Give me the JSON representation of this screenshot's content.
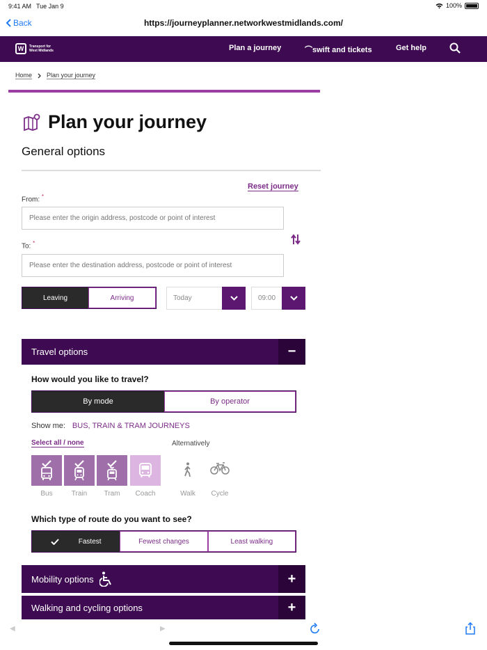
{
  "status": {
    "time": "9:41 AM",
    "date": "Tue Jan 9",
    "battery": "100%"
  },
  "browser": {
    "back_label": "Back",
    "url": "https://journeyplanner.networkwestmidlands.com/"
  },
  "nav": {
    "logo_line1": "Transport for",
    "logo_line2": "West Midlands",
    "links": [
      "Plan a journey",
      "⌒swift and tickets",
      "Get help"
    ]
  },
  "breadcrumb": {
    "home": "Home",
    "current": "Plan your journey"
  },
  "page": {
    "title": "Plan your journey",
    "section": "General options",
    "reset": "Reset journey"
  },
  "form": {
    "from_label": "From:",
    "to_label": "To:",
    "required_mark": "*",
    "from_placeholder": "Please enter the origin address, postcode or point of interest",
    "to_placeholder": "Please enter the destination address, postcode or point of interest",
    "leaving": "Leaving",
    "arriving": "Arriving",
    "day": "Today",
    "time": "09:00"
  },
  "travel": {
    "heading": "Travel options",
    "toggle_symbol": "−",
    "question": "How would you like to travel?",
    "by_mode": "By mode",
    "by_operator": "By operator",
    "show_me_label": "Show me:",
    "show_me_value": "BUS, TRAIN & TRAM JOURNEYS",
    "select_all": "Select all / none",
    "alternatively": "Alternatively",
    "modes": [
      "Bus",
      "Train",
      "Tram",
      "Coach"
    ],
    "alt_modes": [
      "Walk",
      "Cycle"
    ],
    "route_question": "Which type of route do you want to see?",
    "routes": [
      "Fastest",
      "Fewest changes",
      "Least walking"
    ]
  },
  "mobility": {
    "heading": "Mobility options",
    "toggle_symbol": "+"
  },
  "walking": {
    "heading": "Walking and cycling options",
    "toggle_symbol": "+"
  },
  "colors": {
    "brand": "#3e0b52",
    "accent": "#7b2c87",
    "tile": "#9e6fa8"
  }
}
